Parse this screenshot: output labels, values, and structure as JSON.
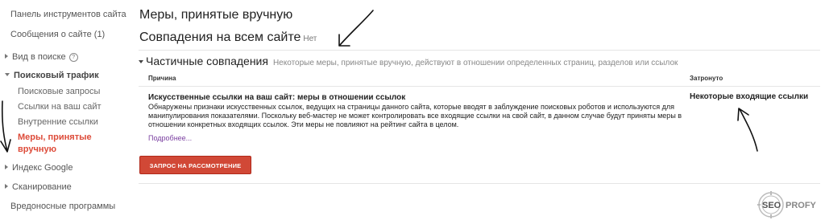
{
  "sidebar": {
    "items": [
      {
        "label": "Панель инструментов сайта"
      },
      {
        "label": "Сообщения о сайте (1)"
      },
      {
        "label": "Вид в поиске"
      },
      {
        "label": "Поисковый трафик"
      },
      {
        "label": "Индекс Google"
      },
      {
        "label": "Сканирование"
      },
      {
        "label": "Вредоносные программы"
      }
    ],
    "traffic_sub": [
      {
        "label": "Поисковые запросы"
      },
      {
        "label": "Ссылки на ваш сайт"
      },
      {
        "label": "Внутренние ссылки"
      },
      {
        "label": "Меры, принятые вручную"
      }
    ]
  },
  "main": {
    "title": "Меры, принятые вручную",
    "site_wide": {
      "label": "Совпадения на всем сайте",
      "value": "Нет"
    },
    "partial": {
      "label": "Частичные совпадения",
      "description": "Некоторые меры, принятые вручную, действуют в отношении определенных страниц, разделов или ссылок"
    },
    "table": {
      "headers": {
        "reason": "Причина",
        "affected": "Затронуто"
      },
      "row": {
        "title": "Искусственные ссылки на ваш сайт: меры в отношении ссылок",
        "text": "Обнаружены признаки искусственных ссылок, ведущих на страницы данного сайта, которые вводят в заблуждение поисковых роботов и используются для манипулирования показателями. Поскольку веб-мастер не может контролировать все входящие ссылки на свой сайт, в данном случае будут приняты меры в отношении конкретных входящих ссылок. Эти меры не повлияют на рейтинг сайта в целом.",
        "more": "Подробнее...",
        "affected": "Некоторые входящие ссылки"
      }
    },
    "review_button": "ЗАПРОС НА РАССМОТРЕНИЕ"
  },
  "watermark": {
    "left": "SEO",
    "right": "PROFY"
  },
  "colors": {
    "accent_red": "#dd4b39",
    "button_red": "#d14836",
    "link_purple": "#7a3fa0"
  }
}
